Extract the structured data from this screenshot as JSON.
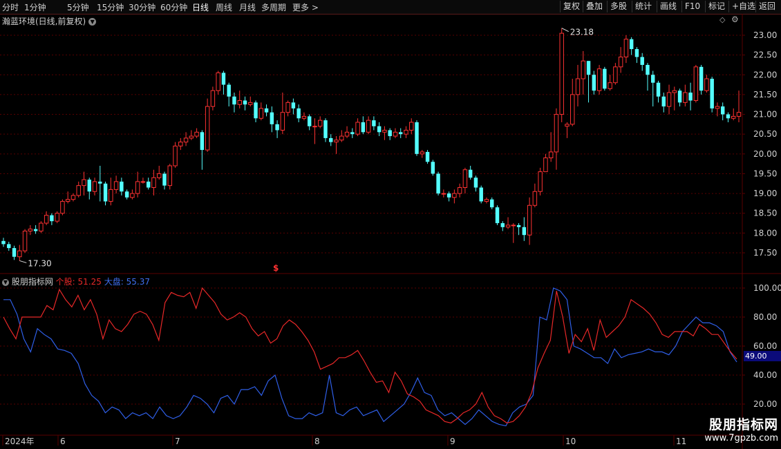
{
  "toolbar": {
    "periods": [
      "分时",
      "1分钟",
      "5分钟",
      "15分钟",
      "30分钟",
      "60分钟",
      "日线",
      "周线",
      "月线",
      "多周期",
      "更多"
    ],
    "active_period": "日线",
    "more_arrow": ">",
    "right_buttons": [
      "复权",
      "叠加",
      "多股",
      "统计",
      "画线",
      "F10",
      "标记",
      "+自选",
      "返回"
    ]
  },
  "main_title": "瀚蓝环境(日线,前复权)",
  "main_title_icon": "chevron-down-icon",
  "corner_icons": [
    "diamond-icon",
    "gear-icon"
  ],
  "price_axis": [
    "23.00",
    "22.50",
    "22.00",
    "21.50",
    "21.00",
    "20.50",
    "20.00",
    "19.50",
    "19.00",
    "18.50",
    "18.00",
    "17.50"
  ],
  "annotations": {
    "high": "23.18",
    "low": "17.30",
    "dividend_marker": "$"
  },
  "indicator": {
    "name": "股朋指标网",
    "stock_label": "个股:",
    "stock_value": "51.25",
    "market_label": "大盘:",
    "market_value": "55.37",
    "axis": [
      "100.00",
      "80.00",
      "60.00",
      "40.00",
      "20.00"
    ],
    "current_label": "49.00"
  },
  "time_axis": [
    "2024年",
    "6",
    "7",
    "8",
    "9",
    "10",
    "11"
  ],
  "colors": {
    "up": "#ff3232",
    "down": "#54ffff",
    "stock_line": "#e82828",
    "market_line": "#2f5fe8",
    "grid": "#5a0000"
  },
  "watermark": {
    "line1": "股朋指标网",
    "line2": "www.7gpzb.com"
  },
  "chart_data": {
    "type": "candlestick",
    "price_range": [
      17.0,
      23.5
    ],
    "candles": [
      [
        17.8,
        17.72,
        17.88,
        17.65
      ],
      [
        17.72,
        17.62,
        17.78,
        17.55
      ],
      [
        17.62,
        17.4,
        17.68,
        17.32
      ],
      [
        17.4,
        17.55,
        17.7,
        17.3
      ],
      [
        17.55,
        18.05,
        18.1,
        17.5
      ],
      [
        18.05,
        18.1,
        18.2,
        17.95
      ],
      [
        18.1,
        18.05,
        18.2,
        17.98
      ],
      [
        18.05,
        18.25,
        18.3,
        18.0
      ],
      [
        18.25,
        18.45,
        18.55,
        18.2
      ],
      [
        18.45,
        18.3,
        18.5,
        18.2
      ],
      [
        18.3,
        18.5,
        18.55,
        18.25
      ],
      [
        18.5,
        18.8,
        18.85,
        18.45
      ],
      [
        18.8,
        18.85,
        19.05,
        18.75
      ],
      [
        18.85,
        18.95,
        19.0,
        18.8
      ],
      [
        18.95,
        19.2,
        19.3,
        18.9
      ],
      [
        19.2,
        19.35,
        19.55,
        18.95
      ],
      [
        19.35,
        19.05,
        19.4,
        18.85
      ],
      [
        19.05,
        19.3,
        19.4,
        18.95
      ],
      [
        19.3,
        19.25,
        19.7,
        18.8
      ],
      [
        19.25,
        18.8,
        19.3,
        18.7
      ],
      [
        18.8,
        19.1,
        19.4,
        18.7
      ],
      [
        19.1,
        19.3,
        19.45,
        19.0
      ],
      [
        19.3,
        19.05,
        19.4,
        18.95
      ],
      [
        19.05,
        18.9,
        19.1,
        18.85
      ],
      [
        18.9,
        19.0,
        19.1,
        18.85
      ],
      [
        19.0,
        19.3,
        19.55,
        18.9
      ],
      [
        19.3,
        19.3,
        19.4,
        19.25
      ],
      [
        19.3,
        19.15,
        19.4,
        19.1
      ],
      [
        19.15,
        19.4,
        19.6,
        18.95
      ],
      [
        19.4,
        19.5,
        19.7,
        19.35
      ],
      [
        19.5,
        19.2,
        19.55,
        19.1
      ],
      [
        19.2,
        19.7,
        19.75,
        19.1
      ],
      [
        19.7,
        20.2,
        20.3,
        19.65
      ],
      [
        20.2,
        20.3,
        20.4,
        20.1
      ],
      [
        20.3,
        20.4,
        20.55,
        20.2
      ],
      [
        20.4,
        20.45,
        20.6,
        20.35
      ],
      [
        20.45,
        20.55,
        20.65,
        20.4
      ],
      [
        20.55,
        20.1,
        20.6,
        19.6
      ],
      [
        20.1,
        21.2,
        21.4,
        20.05
      ],
      [
        21.2,
        21.6,
        21.7,
        21.1
      ],
      [
        21.6,
        22.05,
        22.1,
        21.5
      ],
      [
        22.05,
        21.75,
        22.1,
        21.5
      ],
      [
        21.75,
        21.45,
        21.8,
        21.2
      ],
      [
        21.45,
        21.25,
        21.55,
        21.05
      ],
      [
        21.25,
        21.35,
        21.6,
        21.15
      ],
      [
        21.35,
        21.25,
        21.45,
        21.1
      ],
      [
        21.25,
        21.3,
        21.45,
        21.2
      ],
      [
        21.3,
        20.9,
        21.35,
        20.8
      ],
      [
        20.9,
        21.15,
        21.3,
        20.85
      ],
      [
        21.15,
        21.05,
        21.25,
        20.95
      ],
      [
        21.05,
        20.75,
        21.2,
        20.55
      ],
      [
        20.75,
        20.6,
        20.85,
        20.4
      ],
      [
        20.6,
        21.05,
        21.55,
        20.5
      ],
      [
        21.05,
        21.3,
        21.35,
        20.95
      ],
      [
        21.3,
        21.15,
        21.4,
        21.0
      ],
      [
        21.15,
        20.9,
        21.25,
        20.8
      ],
      [
        20.9,
        20.95,
        21.05,
        20.85
      ],
      [
        20.95,
        20.7,
        21.0,
        20.6
      ],
      [
        20.7,
        20.7,
        20.9,
        20.25
      ],
      [
        20.7,
        20.85,
        20.95,
        20.65
      ],
      [
        20.85,
        20.4,
        20.9,
        20.3
      ],
      [
        20.4,
        20.3,
        20.5,
        20.2
      ],
      [
        20.3,
        20.35,
        20.45,
        20.0
      ],
      [
        20.35,
        20.45,
        20.6,
        20.3
      ],
      [
        20.45,
        20.55,
        20.7,
        20.4
      ],
      [
        20.55,
        20.5,
        20.65,
        20.4
      ],
      [
        20.5,
        20.8,
        20.9,
        20.45
      ],
      [
        20.8,
        20.55,
        20.95,
        20.5
      ],
      [
        20.55,
        20.85,
        20.95,
        20.5
      ],
      [
        20.85,
        20.7,
        20.95,
        20.6
      ],
      [
        20.7,
        20.55,
        20.8,
        20.45
      ],
      [
        20.55,
        20.6,
        20.7,
        20.35
      ],
      [
        20.6,
        20.45,
        20.65,
        20.35
      ],
      [
        20.45,
        20.55,
        20.65,
        20.4
      ],
      [
        20.55,
        20.5,
        20.65,
        20.4
      ],
      [
        20.5,
        20.6,
        20.7,
        20.4
      ],
      [
        20.6,
        20.8,
        20.9,
        20.5
      ],
      [
        20.8,
        20.0,
        20.85,
        19.95
      ],
      [
        20.0,
        20.05,
        20.1,
        19.9
      ],
      [
        20.05,
        19.8,
        20.1,
        19.75
      ],
      [
        19.8,
        19.5,
        19.85,
        19.45
      ],
      [
        19.5,
        19.0,
        19.55,
        18.95
      ],
      [
        19.0,
        19.0,
        19.1,
        18.9
      ],
      [
        19.0,
        18.9,
        19.05,
        18.8
      ],
      [
        18.9,
        19.0,
        19.1,
        18.75
      ],
      [
        19.0,
        19.15,
        19.25,
        18.9
      ],
      [
        19.15,
        19.6,
        19.65,
        19.0
      ],
      [
        19.6,
        19.4,
        19.7,
        19.35
      ],
      [
        19.4,
        19.15,
        19.45,
        19.05
      ],
      [
        19.15,
        18.8,
        19.2,
        18.75
      ],
      [
        18.8,
        18.85,
        18.9,
        18.75
      ],
      [
        18.85,
        18.65,
        18.9,
        18.6
      ],
      [
        18.65,
        18.25,
        18.7,
        18.2
      ],
      [
        18.25,
        18.15,
        18.3,
        18.05
      ],
      [
        18.15,
        18.2,
        18.4,
        18.1
      ],
      [
        18.2,
        18.2,
        18.25,
        17.75
      ],
      [
        18.2,
        18.15,
        18.25,
        17.95
      ],
      [
        18.15,
        17.95,
        18.4,
        17.8
      ],
      [
        17.95,
        18.7,
        18.9,
        17.7
      ],
      [
        18.7,
        19.05,
        19.25,
        18.65
      ],
      [
        19.05,
        19.55,
        19.65,
        18.95
      ],
      [
        19.55,
        19.9,
        20.0,
        19.85
      ],
      [
        19.9,
        20.05,
        20.55,
        19.8
      ],
      [
        20.05,
        21.0,
        21.15,
        19.6
      ],
      [
        21.0,
        23.05,
        23.18,
        20.8
      ],
      [
        20.7,
        20.75,
        20.8,
        20.4
      ],
      [
        20.75,
        21.5,
        21.9,
        20.7
      ],
      [
        21.5,
        21.9,
        22.25,
        21.2
      ],
      [
        21.9,
        22.35,
        22.6,
        21.5
      ],
      [
        22.35,
        22.0,
        22.35,
        21.3
      ],
      [
        22.0,
        21.6,
        22.1,
        21.5
      ],
      [
        21.6,
        22.15,
        22.25,
        21.5
      ],
      [
        22.15,
        21.65,
        22.2,
        21.6
      ],
      [
        21.65,
        21.8,
        22.0,
        21.6
      ],
      [
        21.8,
        22.2,
        22.3,
        21.75
      ],
      [
        22.2,
        22.45,
        22.7,
        22.05
      ],
      [
        22.45,
        22.9,
        23.0,
        22.3
      ],
      [
        22.9,
        22.65,
        22.95,
        22.5
      ],
      [
        22.65,
        22.45,
        22.7,
        22.3
      ],
      [
        22.45,
        22.25,
        22.55,
        22.1
      ],
      [
        22.25,
        22.0,
        22.3,
        21.6
      ],
      [
        22.0,
        21.8,
        22.1,
        21.2
      ],
      [
        21.8,
        21.45,
        21.85,
        21.3
      ],
      [
        21.45,
        21.2,
        21.55,
        21.05
      ],
      [
        21.2,
        21.55,
        21.75,
        21.0
      ],
      [
        21.55,
        21.6,
        21.7,
        21.1
      ],
      [
        21.6,
        21.3,
        21.65,
        21.2
      ],
      [
        21.3,
        21.55,
        21.75,
        21.2
      ],
      [
        21.55,
        21.35,
        21.8,
        21.1
      ],
      [
        21.35,
        22.2,
        22.25,
        21.3
      ],
      [
        22.2,
        21.6,
        22.25,
        21.5
      ],
      [
        21.6,
        21.9,
        22.0,
        21.55
      ],
      [
        21.9,
        21.15,
        21.95,
        21.05
      ],
      [
        21.15,
        21.2,
        21.3,
        20.95
      ],
      [
        21.2,
        21.0,
        21.3,
        20.85
      ],
      [
        21.0,
        20.9,
        21.05,
        20.8
      ],
      [
        20.9,
        20.95,
        21.15,
        20.85
      ],
      [
        20.95,
        21.05,
        21.6,
        20.8
      ]
    ],
    "stock_series": [
      80,
      72,
      65,
      80,
      80,
      80,
      80,
      88,
      85,
      99,
      92,
      87,
      95,
      85,
      92,
      82,
      65,
      78,
      72,
      70,
      75,
      82,
      84,
      82,
      75,
      64,
      90,
      97,
      95,
      94,
      97,
      86,
      100,
      95,
      90,
      82,
      78,
      80,
      83,
      80,
      72,
      67,
      70,
      62,
      65,
      74,
      78,
      75,
      70,
      64,
      56,
      44,
      46,
      48,
      52,
      52,
      54,
      57,
      50,
      42,
      35,
      36,
      28,
      42,
      36,
      27,
      25,
      22,
      16,
      14,
      12,
      8,
      7,
      10,
      14,
      16,
      20,
      28,
      18,
      12,
      10,
      7,
      8,
      12,
      18,
      28,
      45,
      55,
      64,
      98,
      80,
      55,
      68,
      63,
      72,
      57,
      78,
      66,
      70,
      74,
      80,
      92,
      89,
      86,
      82,
      76,
      68,
      66,
      70,
      70,
      70,
      67,
      75,
      72,
      68,
      68,
      62,
      56,
      51
    ],
    "market_series": [
      92,
      92,
      82,
      65,
      56,
      72,
      68,
      65,
      58,
      57,
      55,
      48,
      34,
      26,
      22,
      14,
      18,
      16,
      10,
      14,
      12,
      14,
      10,
      18,
      12,
      10,
      12,
      18,
      26,
      24,
      20,
      14,
      24,
      26,
      20,
      30,
      30,
      32,
      26,
      36,
      40,
      24,
      12,
      10,
      10,
      14,
      12,
      14,
      40,
      14,
      12,
      16,
      18,
      12,
      14,
      16,
      8,
      12,
      16,
      20,
      28,
      38,
      28,
      26,
      16,
      12,
      14,
      10,
      6,
      10,
      16,
      12,
      8,
      6,
      5,
      14,
      18,
      20,
      26,
      80,
      78,
      100,
      98,
      92,
      60,
      58,
      55,
      52,
      52,
      48,
      58,
      52,
      54,
      55,
      56,
      58,
      56,
      56,
      54,
      60,
      70,
      75,
      80,
      76,
      76,
      74,
      70,
      56,
      49
    ],
    "indicator_range": [
      0,
      100
    ]
  }
}
